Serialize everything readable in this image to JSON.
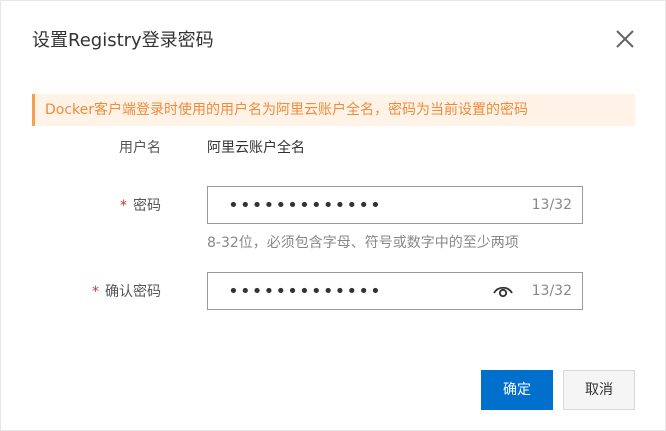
{
  "dialog": {
    "title": "设置Registry登录密码",
    "close_icon": "close-icon"
  },
  "notice": {
    "text": "Docker客户端登录时使用的用户名为阿里云账户全名，密码为当前设置的密码",
    "accent_color": "#f5a050",
    "background_color": "#fff3e8"
  },
  "form": {
    "username": {
      "label": "用户名",
      "value": "阿里云账户全名"
    },
    "password": {
      "required_mark": "*",
      "label": "密码",
      "value": "•••••••••••••",
      "counter": "13/32",
      "hint": "8-32位，必须包含字母、符号或数字中的至少两项"
    },
    "confirm_password": {
      "required_mark": "*",
      "label": "确认密码",
      "value": "•••••••••••••",
      "counter": "13/32",
      "toggle_icon": "eye-icon"
    }
  },
  "buttons": {
    "confirm": "确定",
    "cancel": "取消",
    "primary_color": "#0070cc"
  }
}
